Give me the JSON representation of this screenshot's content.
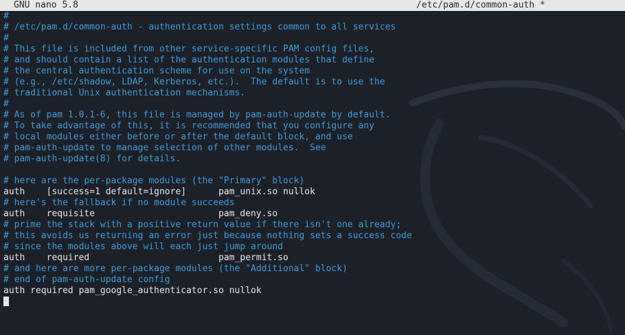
{
  "titlebar": {
    "app": "GNU nano 5.8",
    "file": "/etc/pam.d/common-auth *"
  },
  "editor": {
    "lines": [
      {
        "kind": "comment",
        "text": "#"
      },
      {
        "kind": "comment",
        "text": "# /etc/pam.d/common-auth - authentication settings common to all services"
      },
      {
        "kind": "comment",
        "text": "#"
      },
      {
        "kind": "comment",
        "text": "# This file is included from other service-specific PAM config files,"
      },
      {
        "kind": "comment",
        "text": "# and should contain a list of the authentication modules that define"
      },
      {
        "kind": "comment",
        "text": "# the central authentication scheme for use on the system"
      },
      {
        "kind": "comment",
        "text": "# (e.g., /etc/shadow, LDAP, Kerberos, etc.).  The default is to use the"
      },
      {
        "kind": "comment",
        "text": "# traditional Unix authentication mechanisms."
      },
      {
        "kind": "comment",
        "text": "#"
      },
      {
        "kind": "comment",
        "text": "# As of pam 1.0.1-6, this file is managed by pam-auth-update by default."
      },
      {
        "kind": "comment",
        "text": "# To take advantage of this, it is recommended that you configure any"
      },
      {
        "kind": "comment",
        "text": "# local modules either before or after the default block, and use"
      },
      {
        "kind": "comment",
        "text": "# pam-auth-update to manage selection of other modules.  See"
      },
      {
        "kind": "comment",
        "text": "# pam-auth-update(8) for details."
      },
      {
        "kind": "blank",
        "text": ""
      },
      {
        "kind": "comment",
        "text": "# here are the per-package modules (the \"Primary\" block)"
      },
      {
        "kind": "code",
        "text": "auth\t[success=1 default=ignore]\tpam_unix.so nullok"
      },
      {
        "kind": "comment",
        "text": "# here's the fallback if no module succeeds"
      },
      {
        "kind": "code",
        "text": "auth\trequisite\t\t\tpam_deny.so"
      },
      {
        "kind": "comment",
        "text": "# prime the stack with a positive return value if there isn't one already;"
      },
      {
        "kind": "comment",
        "text": "# this avoids us returning an error just because nothing sets a success code"
      },
      {
        "kind": "comment",
        "text": "# since the modules above will each just jump around"
      },
      {
        "kind": "code",
        "text": "auth\trequired\t\t\tpam_permit.so"
      },
      {
        "kind": "comment",
        "text": "# and here are more per-package modules (the \"Additional\" block)"
      },
      {
        "kind": "comment",
        "text": "# end of pam-auth-update config"
      },
      {
        "kind": "code",
        "text": "auth required pam_google_authenticator.so nullok"
      }
    ]
  },
  "colors": {
    "background": "#1b2029",
    "comment": "#3f9bd6",
    "text": "#e6e6e6",
    "titlebar": "#e8e8e8"
  }
}
